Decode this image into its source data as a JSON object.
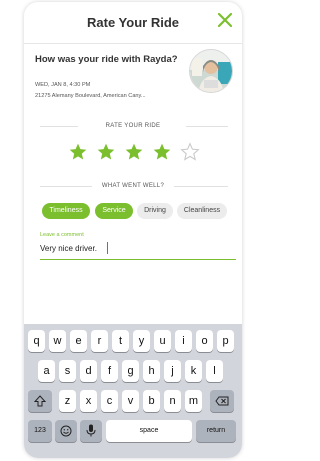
{
  "header": {
    "title": "Rate Your Ride",
    "close_icon": "close-x-icon",
    "accent": "#7bbf2e"
  },
  "ride": {
    "question": "How was your ride with Rayda?",
    "datetime": "WED, JAN 8, 4:30 PM",
    "address": "21275 Alemany Boulevard, American Cany..."
  },
  "rating": {
    "label": "RATE YOUR RIDE",
    "stars": 4,
    "max": 5
  },
  "feedback": {
    "label": "WHAT WENT WELL?",
    "chips": [
      {
        "label": "Timeliness",
        "selected": true
      },
      {
        "label": "Service",
        "selected": true
      },
      {
        "label": "Driving",
        "selected": false
      },
      {
        "label": "Cleanliness",
        "selected": false
      }
    ]
  },
  "comment": {
    "label": "Leave a comment",
    "value": "Very nice driver."
  },
  "keyboard": {
    "row1": [
      "q",
      "w",
      "e",
      "r",
      "t",
      "y",
      "u",
      "i",
      "o",
      "p"
    ],
    "row2": [
      "a",
      "s",
      "d",
      "f",
      "g",
      "h",
      "j",
      "k",
      "l"
    ],
    "row3": [
      "z",
      "x",
      "c",
      "v",
      "b",
      "n",
      "m"
    ],
    "numbers_key": "123",
    "space_key": "space",
    "return_key": "return"
  }
}
